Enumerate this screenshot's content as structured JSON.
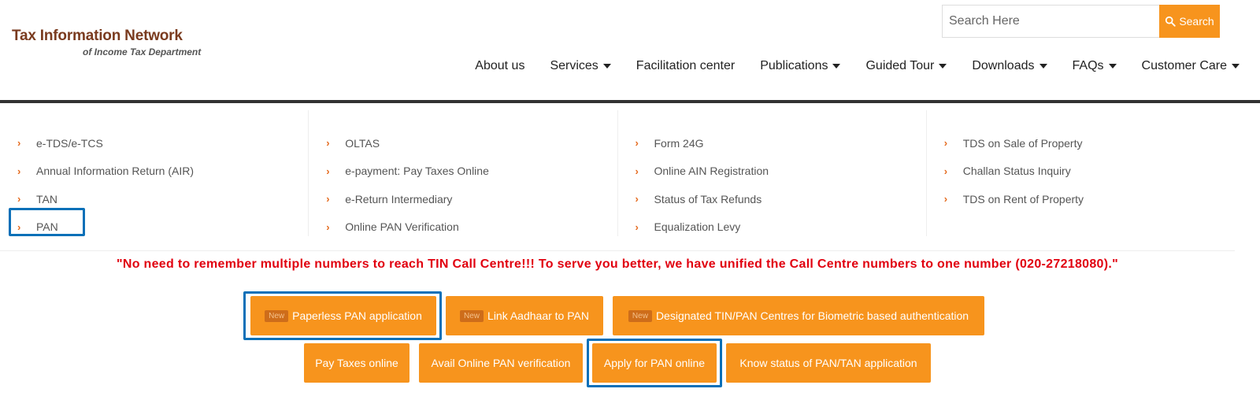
{
  "header": {
    "logo_title": "Tax Information Network",
    "logo_subtitle": "of Income Tax Department"
  },
  "search": {
    "placeholder": "Search Here",
    "button_label": "Search"
  },
  "nav": {
    "items": [
      {
        "label": "About us"
      },
      {
        "label": "Services"
      },
      {
        "label": "Facilitation center"
      },
      {
        "label": "Publications"
      },
      {
        "label": "Guided Tour"
      },
      {
        "label": "Downloads"
      },
      {
        "label": "FAQs"
      },
      {
        "label": "Customer Care"
      }
    ]
  },
  "links": {
    "col1": [
      "e-TDS/e-TCS",
      "Annual Information Return (AIR)",
      "TAN",
      "PAN"
    ],
    "col2": [
      "OLTAS",
      "e-payment: Pay Taxes Online",
      "e-Return Intermediary",
      "Online PAN Verification"
    ],
    "col3": [
      "Form 24G",
      "Online AIN Registration",
      "Status of Tax Refunds",
      "Equalization Levy"
    ],
    "col4": [
      "TDS on Sale of Property",
      "Challan Status Inquiry",
      "TDS on Rent of Property"
    ]
  },
  "notice": "\"No need to remember multiple numbers to reach TIN Call Centre!!! To serve you better, we have unified the Call Centre numbers to one number (020-27218080).\"",
  "buttons": {
    "new_tag": "New",
    "row1": [
      "Paperless PAN application",
      "Link Aadhaar to PAN",
      "Designated TIN/PAN Centres for Biometric based authentication"
    ],
    "row2": [
      "Pay Taxes online",
      "Avail Online PAN verification",
      "Apply for PAN online",
      "Know status of PAN/TAN application"
    ]
  },
  "colors": {
    "accent": "#f7941d",
    "highlight": "#0a70b8",
    "notice": "#e1000f",
    "brand": "#7a3b1f"
  }
}
